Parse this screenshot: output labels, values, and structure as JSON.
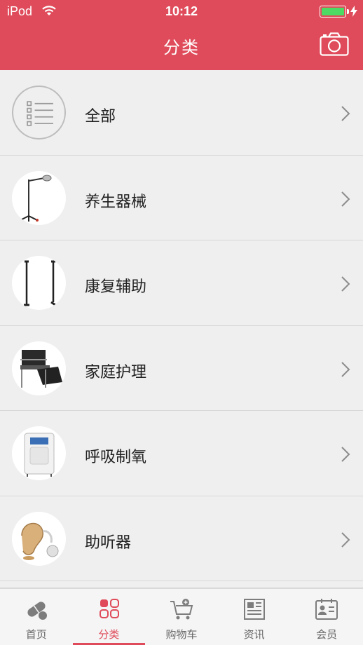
{
  "status_bar": {
    "carrier": "iPod",
    "time": "10:12",
    "battery_level": 1.0
  },
  "header": {
    "title": "分类",
    "camera_icon": "camera-icon"
  },
  "categories": [
    {
      "label": "全部",
      "icon": "list-icon"
    },
    {
      "label": "养生器械",
      "icon": "lamp-stand-image"
    },
    {
      "label": "康复辅助",
      "icon": "crutches-image"
    },
    {
      "label": "家庭护理",
      "icon": "commode-chair-image"
    },
    {
      "label": "呼吸制氧",
      "icon": "oxygen-concentrator-image"
    },
    {
      "label": "助听器",
      "icon": "hearing-aid-image"
    }
  ],
  "tabbar": {
    "active_index": 1,
    "accent_color": "#df4b5a",
    "tabs": [
      {
        "label": "首页",
        "icon": "pills-icon"
      },
      {
        "label": "分类",
        "icon": "grid-icon"
      },
      {
        "label": "购物车",
        "icon": "cart-icon"
      },
      {
        "label": "资讯",
        "icon": "news-icon"
      },
      {
        "label": "会员",
        "icon": "member-card-icon"
      }
    ]
  }
}
